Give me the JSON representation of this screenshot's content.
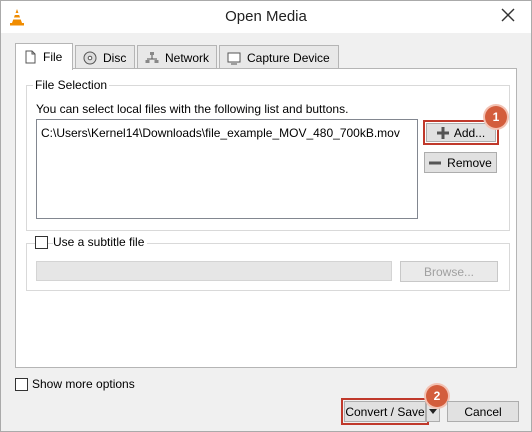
{
  "window": {
    "title": "Open Media"
  },
  "tabs": [
    {
      "label": "File",
      "icon": "file-icon"
    },
    {
      "label": "Disc",
      "icon": "disc-icon"
    },
    {
      "label": "Network",
      "icon": "network-icon"
    },
    {
      "label": "Capture Device",
      "icon": "capture-device-icon"
    }
  ],
  "file_selection": {
    "group_title": "File Selection",
    "hint": "You can select local files with the following list and buttons.",
    "files": [
      "C:\\Users\\Kernel14\\Downloads\\file_example_MOV_480_700kB.mov"
    ],
    "add_label": "Add...",
    "remove_label": "Remove"
  },
  "subtitle": {
    "checkbox_label": "Use a subtitle file",
    "input_value": "",
    "browse_label": "Browse..."
  },
  "footer": {
    "show_more_label": "Show more options",
    "convert_label": "Convert / Save",
    "cancel_label": "Cancel"
  },
  "annotations": {
    "step1": "1",
    "step2": "2",
    "accent": "#d35d3c"
  }
}
